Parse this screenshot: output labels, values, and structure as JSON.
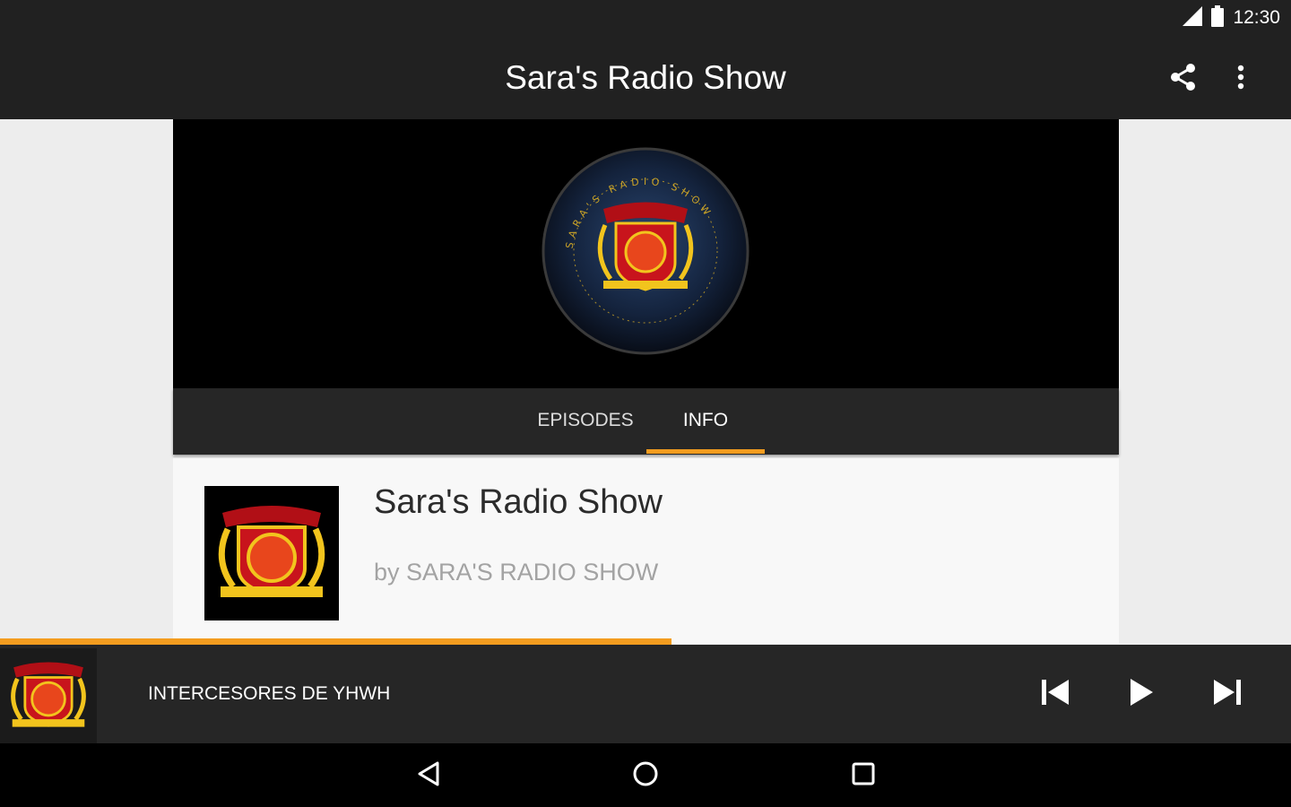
{
  "status_bar": {
    "time": "12:30",
    "icons": [
      "signal-icon",
      "battery-icon"
    ]
  },
  "toolbar": {
    "title": "Sara's Radio Show",
    "actions": [
      "share-icon",
      "more-vert-icon"
    ]
  },
  "tabs": [
    {
      "label": "EPISODES",
      "selected": false
    },
    {
      "label": "INFO",
      "selected": true
    }
  ],
  "podcast": {
    "title": "Sara's Radio Show",
    "author": "by SARA'S RADIO SHOW",
    "logo_text": "SARA'S RADIO SHOW"
  },
  "player": {
    "now_playing": "INTERCESORES DE YHWH",
    "progress": 0.52,
    "controls": [
      "skip-previous-icon",
      "play-icon",
      "skip-next-icon"
    ]
  },
  "navbar": {
    "buttons": [
      "back-icon",
      "home-icon",
      "recents-icon"
    ]
  },
  "colors": {
    "accent": "#f39c1f",
    "toolbar": "#212121",
    "emblem_red": "#c8141c",
    "emblem_gold": "#f2c41d"
  }
}
